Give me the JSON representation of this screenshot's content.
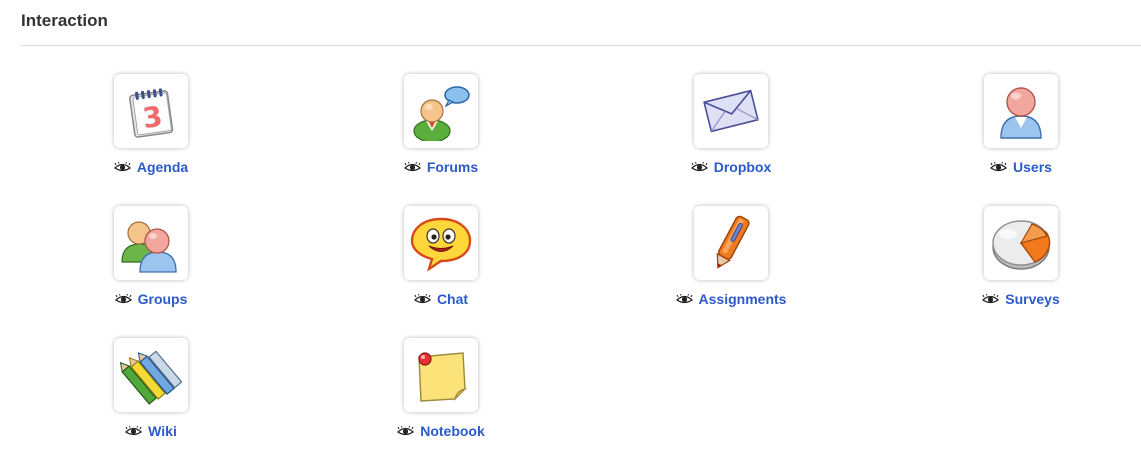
{
  "section": {
    "title": "Interaction"
  },
  "colors": {
    "link": "#2b5ac9",
    "title": "#333333",
    "divider": "#dcdcdc"
  },
  "tools": [
    {
      "label": "Agenda",
      "icon": "agenda-calendar-icon"
    },
    {
      "label": "Forums",
      "icon": "forums-icon"
    },
    {
      "label": "Dropbox",
      "icon": "dropbox-envelope-icon"
    },
    {
      "label": "Users",
      "icon": "users-icon"
    },
    {
      "label": "Groups",
      "icon": "groups-icon"
    },
    {
      "label": "Chat",
      "icon": "chat-icon"
    },
    {
      "label": "Assignments",
      "icon": "assignments-pen-icon"
    },
    {
      "label": "Surveys",
      "icon": "surveys-pie-icon"
    },
    {
      "label": "Wiki",
      "icon": "wiki-pencils-icon"
    },
    {
      "label": "Notebook",
      "icon": "notebook-note-icon"
    }
  ]
}
